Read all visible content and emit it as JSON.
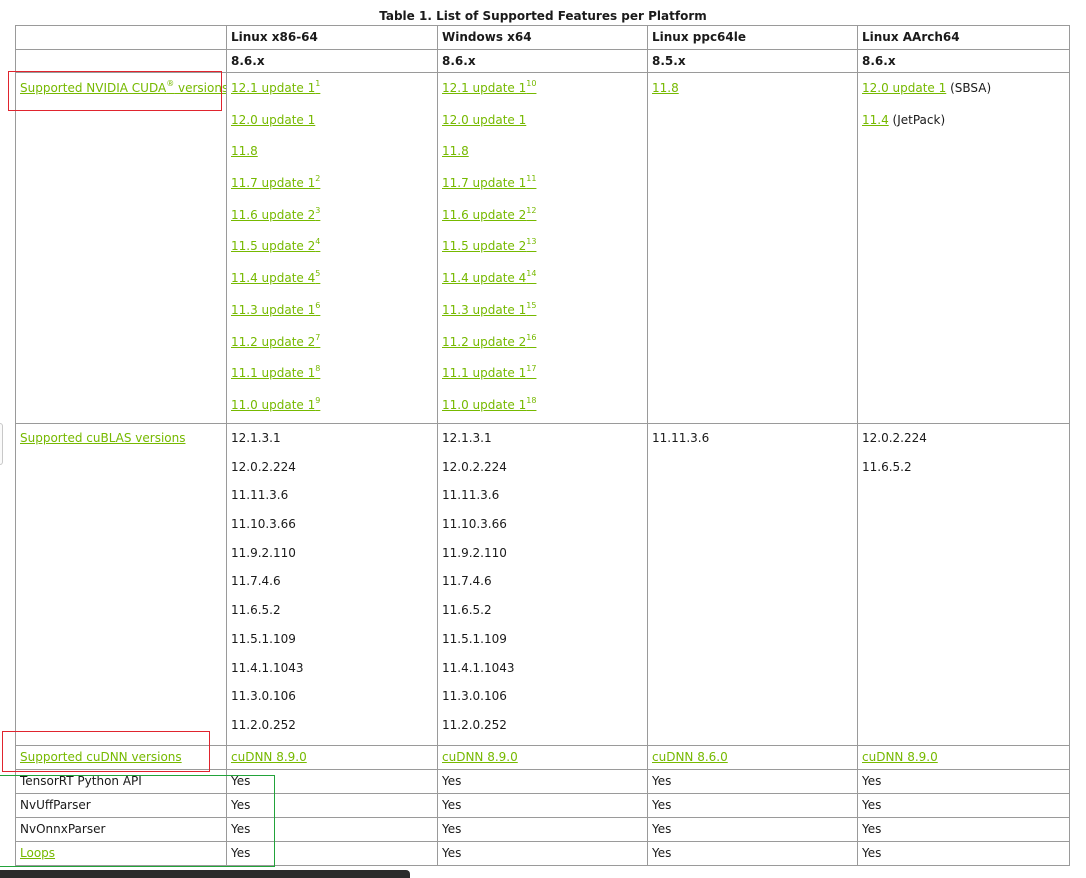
{
  "caption": "Table 1. List of Supported Features per Platform",
  "header": {
    "platforms": [
      "Linux x86-64",
      "Windows x64",
      "Linux ppc64le",
      "Linux AArch64"
    ],
    "versions": [
      "8.6.x",
      "8.6.x",
      "8.5.x",
      "8.6.x"
    ]
  },
  "rows": {
    "cuda": {
      "label_pre": "Supported NVIDIA CUDA",
      "label_reg": "®",
      "label_post": " versions",
      "linux_x86": [
        {
          "text": "12.1 update 1",
          "sup": "1"
        },
        {
          "text": "12.0 update 1",
          "sup": ""
        },
        {
          "text": "11.8",
          "sup": ""
        },
        {
          "text": "11.7 update 1",
          "sup": "2"
        },
        {
          "text": "11.6 update 2",
          "sup": "3"
        },
        {
          "text": "11.5 update 2",
          "sup": "4"
        },
        {
          "text": "11.4 update 4",
          "sup": "5"
        },
        {
          "text": "11.3 update 1",
          "sup": "6"
        },
        {
          "text": "11.2 update 2",
          "sup": "7"
        },
        {
          "text": "11.1 update 1",
          "sup": "8"
        },
        {
          "text": "11.0 update 1",
          "sup": "9"
        }
      ],
      "windows": [
        {
          "text": "12.1 update 1",
          "sup": "10"
        },
        {
          "text": "12.0 update 1",
          "sup": ""
        },
        {
          "text": "11.8",
          "sup": ""
        },
        {
          "text": "11.7 update 1",
          "sup": "11"
        },
        {
          "text": "11.6 update 2",
          "sup": "12"
        },
        {
          "text": "11.5 update 2",
          "sup": "13"
        },
        {
          "text": "11.4 update 4",
          "sup": "14"
        },
        {
          "text": "11.3 update 1",
          "sup": "15"
        },
        {
          "text": "11.2 update 2",
          "sup": "16"
        },
        {
          "text": "11.1 update 1",
          "sup": "17"
        },
        {
          "text": "11.0 update 1",
          "sup": "18"
        }
      ],
      "ppc": [
        {
          "text": "11.8",
          "note": ""
        }
      ],
      "aarch": [
        {
          "text": "12.0 update 1",
          "note": " (SBSA)"
        },
        {
          "text": "11.4",
          "note": " (JetPack)"
        }
      ]
    },
    "cublas": {
      "label": "Supported cuBLAS versions",
      "linux_x86": [
        "12.1.3.1",
        "12.0.2.224",
        "11.11.3.6",
        "11.10.3.66",
        "11.9.2.110",
        "11.7.4.6",
        "11.6.5.2",
        "11.5.1.109",
        "11.4.1.1043",
        "11.3.0.106",
        "11.2.0.252"
      ],
      "windows": [
        "12.1.3.1",
        "12.0.2.224",
        "11.11.3.6",
        "11.10.3.66",
        "11.9.2.110",
        "11.7.4.6",
        "11.6.5.2",
        "11.5.1.109",
        "11.4.1.1043",
        "11.3.0.106",
        "11.2.0.252"
      ],
      "ppc": [
        "11.11.3.6"
      ],
      "aarch": [
        "12.0.2.224",
        "11.6.5.2"
      ]
    },
    "cudnn": {
      "label": "Supported cuDNN versions",
      "values": [
        "cuDNN 8.9.0",
        "cuDNN 8.9.0",
        "cuDNN 8.6.0",
        "cuDNN 8.9.0"
      ]
    },
    "python_api": {
      "label": "TensorRT Python API",
      "values": [
        "Yes",
        "Yes",
        "Yes",
        "Yes"
      ]
    },
    "uff": {
      "label": "NvUffParser",
      "values": [
        "Yes",
        "Yes",
        "Yes",
        "Yes"
      ]
    },
    "onnx": {
      "label": "NvOnnxParser",
      "values": [
        "Yes",
        "Yes",
        "Yes",
        "Yes"
      ]
    },
    "loops": {
      "label": "Loops",
      "values": [
        "Yes",
        "Yes",
        "Yes",
        "Yes"
      ]
    }
  },
  "colors": {
    "link": "#76b900",
    "highlight_red": "#e0242e",
    "highlight_green": "#22a33a",
    "border": "#9a9a9a"
  }
}
